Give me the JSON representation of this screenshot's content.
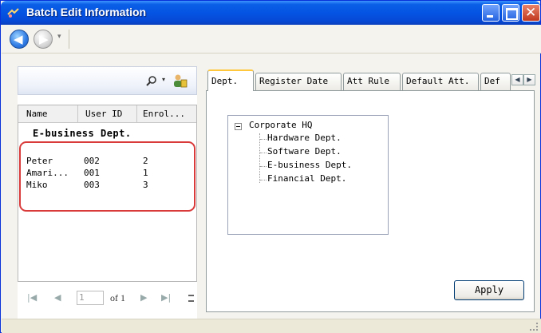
{
  "window": {
    "title": "Batch Edit Information",
    "colors": {
      "titlebar": "#0554e3",
      "close": "#c0391e",
      "highlight": "#d93a3a",
      "active_tab_top": "#ffc83c"
    }
  },
  "nav": {
    "back_icon": "back-arrow-icon",
    "forward_icon": "forward-arrow-icon",
    "dropdown_glyph": "▾"
  },
  "search": {
    "placeholder": "",
    "search_glyph": "search-icon",
    "dropdown_glyph": "▾",
    "user_glyph": "user-icon"
  },
  "grid": {
    "columns": [
      "Name",
      "User ID",
      "Enrol..."
    ],
    "group": "E-business Dept.",
    "rows": [
      {
        "name": "Peter",
        "user_id": "002",
        "enroll": "2"
      },
      {
        "name": "Amari...",
        "user_id": "001",
        "enroll": "1"
      },
      {
        "name": "Miko",
        "user_id": "003",
        "enroll": "3"
      }
    ]
  },
  "pager": {
    "first": "|◀",
    "prev": "◀",
    "page": "1",
    "of_text": "of 1",
    "next": "▶",
    "last": "▶|"
  },
  "tabs": [
    {
      "label": "Dept."
    },
    {
      "label": "Register Date"
    },
    {
      "label": "Att Rule"
    },
    {
      "label": "Default Att."
    },
    {
      "label": "Def"
    }
  ],
  "tab_scroll": {
    "left": "◀",
    "right": "▶"
  },
  "tree": {
    "root": "Corporate HQ",
    "children": [
      "Hardware Dept.",
      "Software Dept.",
      "E-business Dept.",
      "Financial Dept."
    ]
  },
  "apply_label": "Apply"
}
